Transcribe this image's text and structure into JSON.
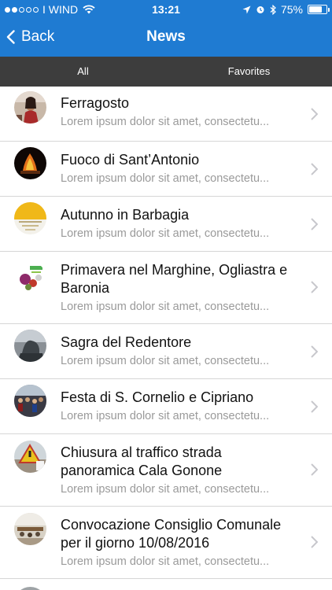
{
  "status": {
    "carrier": "I WIND",
    "time": "13:21",
    "battery": "75%",
    "battery_level": 0.75,
    "icons": [
      "signal-dots-icon",
      "wifi-icon",
      "location-arrow-icon",
      "alarm-icon",
      "bluetooth-icon",
      "battery-icon"
    ]
  },
  "nav": {
    "back_label": "Back",
    "title": "News"
  },
  "tabs": [
    {
      "label": "All"
    },
    {
      "label": "Favorites"
    }
  ],
  "items": [
    {
      "title": "Ferragosto",
      "subtitle": "Lorem ipsum dolor sit amet, consectetu...",
      "thumb": "festival-woman-thumbnail"
    },
    {
      "title": "Fuoco di Sant’Antonio",
      "subtitle": "Lorem ipsum dolor sit amet, consectetu...",
      "thumb": "bonfire-thumbnail"
    },
    {
      "title": "Autunno in Barbagia",
      "subtitle": "Lorem ipsum dolor sit amet, consectetu...",
      "thumb": "autumn-poster-thumbnail"
    },
    {
      "title": "Primavera nel Marghine, Ogliastra e Baronia",
      "subtitle": "Lorem ipsum dolor sit amet, consectetu...",
      "thumb": "spring-flowers-thumbnail"
    },
    {
      "title": "Sagra del Redentore",
      "subtitle": "Lorem ipsum dolor sit amet, consectetu...",
      "thumb": "statue-thumbnail"
    },
    {
      "title": "Festa di S. Cornelio e Cipriano",
      "subtitle": "Lorem ipsum dolor sit amet, consectetu...",
      "thumb": "crowd-thumbnail"
    },
    {
      "title": "Chiusura al traffico strada panoramica Cala Gonone",
      "subtitle": "Lorem ipsum dolor sit amet, consectetu...",
      "thumb": "road-sign-thumbnail"
    },
    {
      "title": "Convocazione Consiglio Comunale per il giorno 10/08/2016",
      "subtitle": "Lorem ipsum dolor sit amet, consectetu...",
      "thumb": "council-room-thumbnail"
    }
  ],
  "colors": {
    "nav_bg": "#1f7bd2",
    "tab_bg": "#3d3d3d",
    "subtitle": "#9a9a9a",
    "separator": "#d6d6d6"
  }
}
